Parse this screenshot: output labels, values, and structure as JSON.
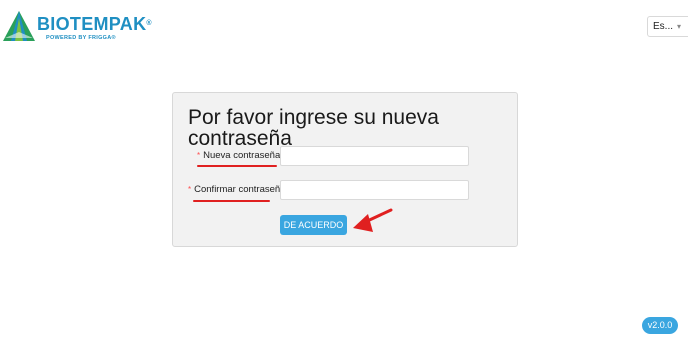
{
  "header": {
    "brand_name": "BIOTEMPAK",
    "brand_registered": "®",
    "brand_tagline": "POWERED BY FRIGGA®",
    "language_selected": "Es..."
  },
  "form": {
    "title": "Por favor ingrese su nueva contraseña",
    "fields": [
      {
        "label": "Nueva contraseña",
        "required": true,
        "value": ""
      },
      {
        "label": "Confirmar contraseña",
        "required": true,
        "value": ""
      }
    ],
    "submit_label": "DE ACUERDO"
  },
  "footer": {
    "version": "v2.0.0"
  },
  "colors": {
    "brand": "#1f8fc2",
    "brand_green": "#2aa05a",
    "button": "#3aa6e0",
    "annotation_red": "#e02020",
    "required_star": "#ff4d4f"
  },
  "icons": {
    "logo": "biotempak-triangle-logo",
    "language_chevron": "chevron-down-icon",
    "annotation": "red-arrow-icon"
  }
}
